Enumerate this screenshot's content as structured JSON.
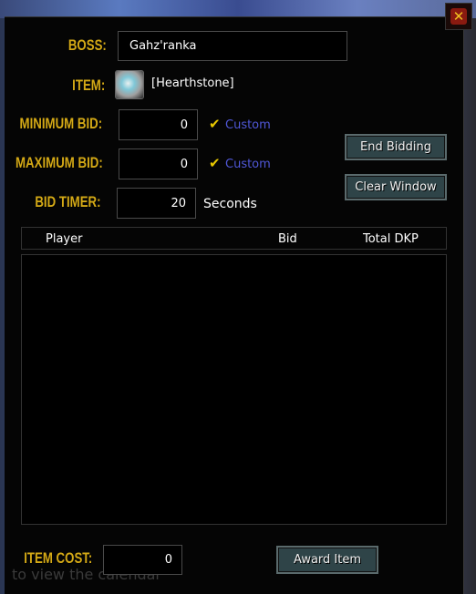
{
  "window": {
    "close_icon": "close-x-icon"
  },
  "boss": {
    "label": "BOSS:",
    "value": "Gahz'ranka"
  },
  "item": {
    "label": "ITEM:",
    "name": "[Hearthstone]",
    "icon": "hearthstone-icon"
  },
  "min_bid": {
    "label": "MINIMUM BID:",
    "value": "0",
    "custom_label": "Custom",
    "custom_checked": true
  },
  "max_bid": {
    "label": "MAXIMUM BID:",
    "value": "0",
    "custom_label": "Custom",
    "custom_checked": true
  },
  "bid_timer": {
    "label": "BID TIMER:",
    "value": "20",
    "unit": "Seconds"
  },
  "buttons": {
    "end_bidding": "End Bidding",
    "clear_window": "Clear Window",
    "award_item": "Award Item"
  },
  "table": {
    "columns": [
      "Player",
      "Bid",
      "Total DKP"
    ],
    "rows": []
  },
  "item_cost": {
    "label": "ITEM COST:",
    "value": "0"
  },
  "background_text": "to view the calendar",
  "colors": {
    "label_gold": "#d4a916",
    "custom_blue": "#5058d8",
    "button_bg": "#2f4448"
  }
}
